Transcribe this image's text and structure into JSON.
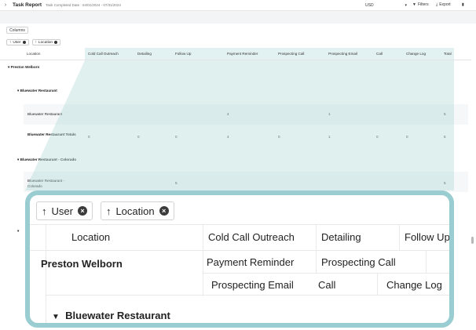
{
  "topbar": {
    "title": "Task Report",
    "subtitle": "Task Completed Date : 04/01/2024 - 07/31/2024",
    "currency": "USD",
    "filters_label": "Filters",
    "export_label": "Export"
  },
  "toolbar": {
    "columns_label": "Columns"
  },
  "groupings": [
    {
      "label": "User",
      "arrow": "↑"
    },
    {
      "label": "Location",
      "arrow": "↑"
    }
  ],
  "columns": [
    "Location",
    "Cold Call Outreach",
    "Detailing",
    "Follow Up",
    "Payment Reminder",
    "Prospecting Call",
    "Prospecting Email",
    "Call",
    "Change Log",
    "Total"
  ],
  "rows": {
    "user": "Preston Welborn",
    "group1": "Bluewater Restaurant",
    "group1_row": {
      "label": "Bluewater Restaurant",
      "payment_reminder": "4",
      "prospecting_email": "1",
      "total": "5"
    },
    "group1_totals": {
      "label": "Bluewater Restaurant Totals",
      "cold_call": "0",
      "detailing": "0",
      "follow_up": "0",
      "payment_reminder": "4",
      "prospecting_call": "0",
      "prospecting_email": "1",
      "call": "0",
      "change_log": "0",
      "total": "5"
    },
    "group2": "Bluewater Restaurant - Colorado",
    "group2_row": {
      "label": "Bluewater Restaurant - Colorado",
      "follow_up": "5",
      "total": "5"
    }
  },
  "zoom": {
    "chip_user": "User",
    "chip_location": "Location",
    "h_location": "Location",
    "h_cold_call": "Cold Call Outreach",
    "h_detailing": "Detailing",
    "h_follow_up": "Follow Up",
    "h_payment": "Payment Reminder",
    "h_prospecting_call": "Prospecting Call",
    "h_prospecting_email": "Prospecting Email",
    "h_call": "Call",
    "h_change_log": "Change Log",
    "user": "Preston Welborn",
    "group1": "Bluewater Restaurant"
  },
  "colors": {
    "accent_teal": "#9acdd1",
    "lens_fill": "#add7d6"
  }
}
